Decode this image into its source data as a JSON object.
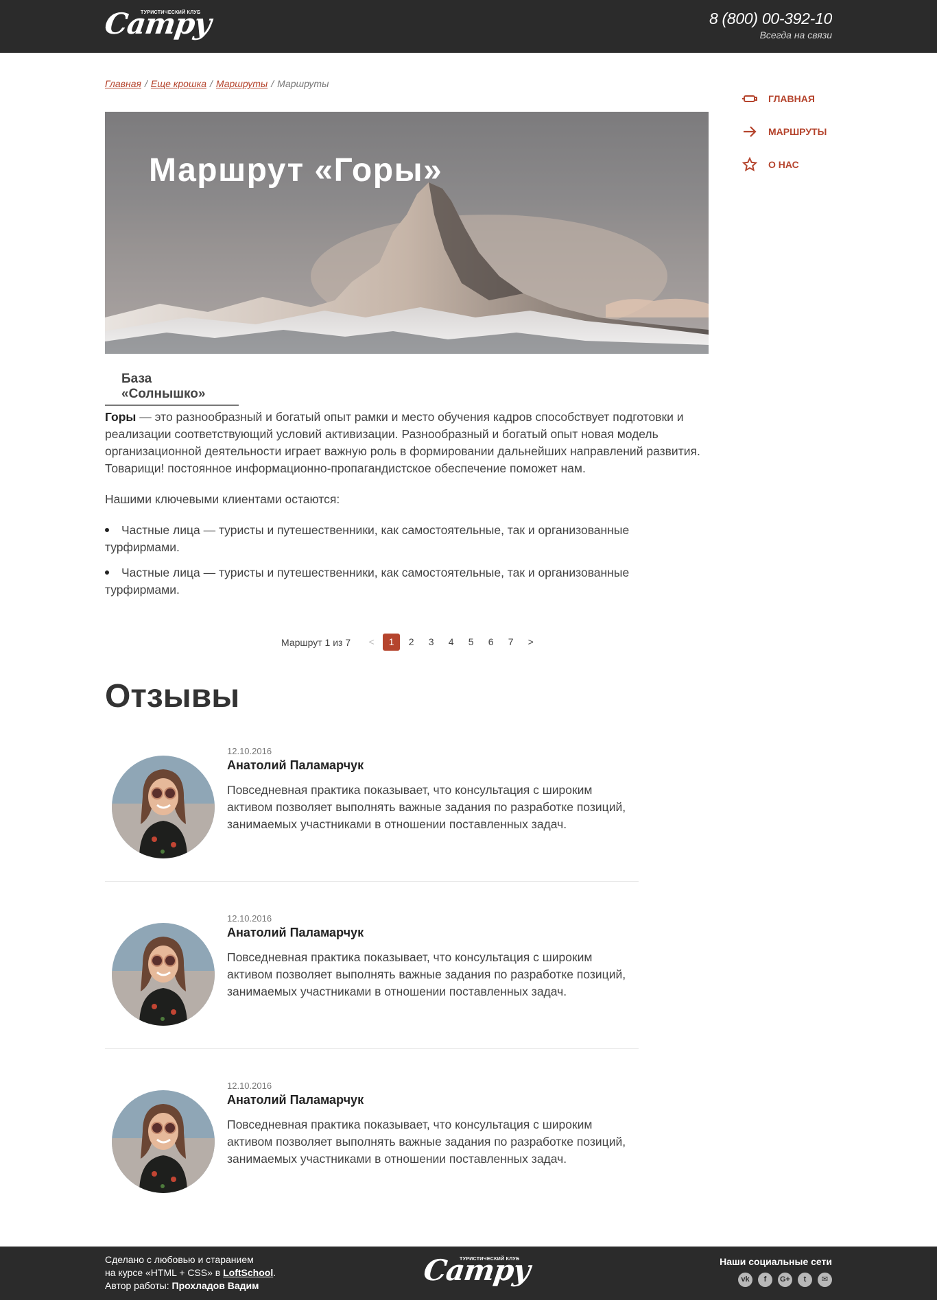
{
  "header": {
    "logo_sub": "ТУРИСТИЧЕСКИЙ КЛУБ",
    "logo_text": "Campy",
    "phone": "8 (800) 00-392-10",
    "phone_sub": "Всегда на связи"
  },
  "breadcrumb": {
    "items": [
      "Главная",
      "Еще крошка",
      "Маршруты"
    ],
    "current": "Маршруты",
    "separator": "/"
  },
  "sidenav": {
    "items": [
      {
        "label": "ГЛАВНАЯ",
        "icon": "tent-icon"
      },
      {
        "label": "МАРШРУТЫ",
        "icon": "arrow-right-icon"
      },
      {
        "label": "О НАС",
        "icon": "star-icon"
      }
    ]
  },
  "hero": {
    "title": "Маршрут «Горы»"
  },
  "base": {
    "label": "База «Солнышко»"
  },
  "content": {
    "lead_bold": "Горы",
    "lead_rest": " — это разнообразный и богатый опыт рамки и место обучения кадров способствует подготовки и реализации соответствующий условий активизации. Разнообразный и богатый опыт новая модель организационной деятельности играет важную роль в формировании дальнейших направлений развития. Товарищи! постоянное информационно-пропагандистское обеспечение поможет нам.",
    "clients_intro": "Нашими ключевыми клиентами остаются:",
    "list": [
      "Частные лица — туристы и путешественники, как самостоятельные, так и организованные турфирмами.",
      "Частные лица — туристы и путешественники, как самостоятельные, так и организованные турфирмами."
    ]
  },
  "pager": {
    "label": "Маршрут 1 из 7",
    "prev": "<",
    "next": ">",
    "pages": [
      "1",
      "2",
      "3",
      "4",
      "5",
      "6",
      "7"
    ],
    "active": "1"
  },
  "reviews": {
    "title": "Отзывы",
    "items": [
      {
        "date": "12.10.2016",
        "name": "Анатолий Паламарчук",
        "text": "Повседневная практика показывает, что консультация с широким активом позволяет выполнять важные задания по разработке позиций, занимаемых участниками в отношении поставленных задач."
      },
      {
        "date": "12.10.2016",
        "name": "Анатолий Паламарчук",
        "text": "Повседневная практика показывает, что консультация с широким активом позволяет выполнять важные задания по разработке позиций, занимаемых участниками в отношении поставленных задач."
      },
      {
        "date": "12.10.2016",
        "name": "Анатолий Паламарчук",
        "text": "Повседневная практика показывает, что консультация с широким активом позволяет выполнять важные задания по разработке позиций, занимаемых участниками в отношении поставленных задач."
      }
    ]
  },
  "footer": {
    "line1": "Сделано с любовью и старанием",
    "line2_pre": "на курсе «HTML + CSS» в ",
    "line2_link": "LoftSchool",
    "line2_post": ".",
    "line3_pre": "Автор работы: ",
    "line3_author": "Прохладов Вадим",
    "social_title": "Наши социальные сети",
    "social": [
      {
        "icon": "vk-icon",
        "glyph": "vk"
      },
      {
        "icon": "facebook-icon",
        "glyph": "f"
      },
      {
        "icon": "google-plus-icon",
        "glyph": "G+"
      },
      {
        "icon": "twitter-icon",
        "glyph": "t"
      },
      {
        "icon": "mail-icon",
        "glyph": "✉"
      }
    ]
  },
  "colors": {
    "accent": "#b5442d",
    "dark_bar": "#2b2b2b"
  }
}
